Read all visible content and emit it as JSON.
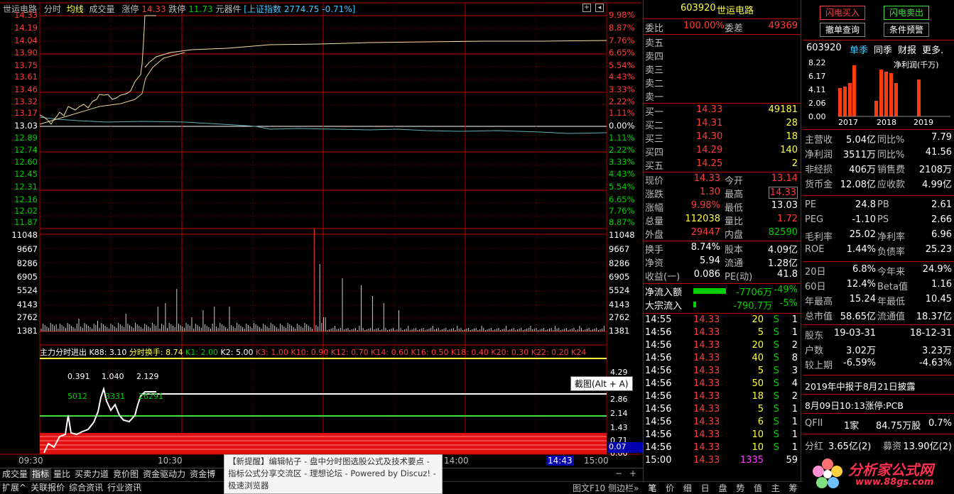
{
  "header": {
    "stock_name": "世运电路",
    "tabs": [
      "分时",
      "均线",
      "成交量"
    ],
    "limit_up_label": "涨停",
    "limit_up_value": "14.33",
    "limit_down_label": "跌停",
    "limit_down_value": "11.73",
    "sector": "元器件",
    "index_text": "[上证指数",
    "index_value": "2774.75 -0.71%]"
  },
  "price_axis": [
    "14.33",
    "14.19",
    "14.04",
    "13.90",
    "13.75",
    "13.61",
    "13.46",
    "13.32",
    "13.17",
    "13.03",
    "12.89",
    "12.74",
    "12.60",
    "12.45",
    "12.31",
    "12.16",
    "12.02",
    "11.87"
  ],
  "pct_axis": [
    "9.98%",
    "8.87%",
    "7.76%",
    "6.65%",
    "5.54%",
    "4.43%",
    "3.33%",
    "2.22%",
    "1.11%",
    "0.00%",
    "1.11%",
    "2.22%",
    "3.33%",
    "4.43%",
    "5.54%",
    "6.65%",
    "7.76%",
    "8.87%"
  ],
  "volume_axis": [
    "11048",
    "9667",
    "8286",
    "6905",
    "5524",
    "4143",
    "2762",
    "1381"
  ],
  "indicator_bar": {
    "name": "主力分时进出",
    "k88": "K88: 3.10",
    "turnover": "分时换手: 8.74",
    "k1": "K1: 2.00",
    "k2": "K2: 5.00",
    "rest": "K3: 1.00  K10: 0.90  K12: 0.70  K14: 0.60  K16: 0.50  K18: 0.40  K20: 0.30  K22: 0.20  K24"
  },
  "indicator_labels": {
    "a": "0.391",
    "b": "1.040",
    "c": "2.129",
    "d": "5012",
    "e": "3331",
    "f": "26291"
  },
  "indicator_axis": [
    "4.29",
    "2.86",
    "2.14",
    "1.43",
    "0.71",
    "0.00"
  ],
  "indicator_current": "0.07",
  "time_axis": {
    "t1": "09:30",
    "t2": "10:30",
    "t3": "14:00",
    "t4": "14:43",
    "t5": "15:00"
  },
  "tooltip": "截图(Alt + A)",
  "bottom_tabs": [
    "成交量",
    "指标",
    "量比",
    "买卖力道",
    "竞价图",
    "资金驱动力",
    "资金博"
  ],
  "bottom_tabs2": [
    "扩展^",
    "关联报价",
    "综合资讯",
    "行业资讯"
  ],
  "bottom_right": {
    "f10": "图文F10",
    "side": "侧边栏»"
  },
  "popup": "【新提醒】编辑帖子 - 盘中分时图选股公式及技术要点 - 指标公式分享交流区 - 理想论坛 - Powered by Discuz! - 极速浏览器",
  "quote": {
    "code": "603920",
    "name": "世运电路",
    "weibi_label": "委比",
    "weibi": "100.00%",
    "weicha_label": "委差",
    "weicha": "49369",
    "sells": [
      "卖五",
      "卖四",
      "卖三",
      "卖二",
      "卖一"
    ],
    "buys": [
      {
        "label": "买一",
        "price": "14.33",
        "vol": "49181"
      },
      {
        "label": "买二",
        "price": "14.31",
        "vol": "28"
      },
      {
        "label": "买三",
        "price": "14.30",
        "vol": "18"
      },
      {
        "label": "买四",
        "price": "14.29",
        "vol": "140"
      },
      {
        "label": "买五",
        "price": "14.25",
        "vol": "2"
      }
    ],
    "stats": [
      {
        "l1": "现价",
        "v1": "14.33",
        "l2": "今开",
        "v2": "13.14"
      },
      {
        "l1": "涨跌",
        "v1": "1.30",
        "l2": "最高",
        "v2": "14.33"
      },
      {
        "l1": "涨幅",
        "v1": "9.98%",
        "l2": "最低",
        "v2": "13.03"
      },
      {
        "l1": "总量",
        "v1": "112038",
        "l2": "量比",
        "v2": "1.72"
      },
      {
        "l1": "外盘",
        "v1": "29447",
        "l2": "内盘",
        "v2": "82590"
      }
    ],
    "stats2": [
      {
        "l1": "换手",
        "v1": "8.74%",
        "l2": "股本",
        "v2": "4.09亿"
      },
      {
        "l1": "净资",
        "v1": "5.94",
        "l2": "流通",
        "v2": "1.28亿"
      },
      {
        "l1": "收益(一)",
        "v1": "0.086",
        "l2": "PE(动)",
        "v2": "41.8"
      }
    ],
    "flow": [
      {
        "label": "净流入额",
        "value": "-7706万",
        "pct": "-49%"
      },
      {
        "label": "大宗流入",
        "value": "-790.7万",
        "pct": "-5%"
      }
    ],
    "ticks": [
      {
        "t": "14:55",
        "p": "14.33",
        "v": "20",
        "s": "S",
        "n": "1"
      },
      {
        "t": "14:56",
        "p": "14.33",
        "v": "5",
        "s": "S",
        "n": "1"
      },
      {
        "t": "14:56",
        "p": "14.33",
        "v": "20",
        "s": "S",
        "n": "2"
      },
      {
        "t": "14:56",
        "p": "14.33",
        "v": "40",
        "s": "S",
        "n": "8"
      },
      {
        "t": "14:56",
        "p": "14.33",
        "v": "5",
        "s": "S",
        "n": "3"
      },
      {
        "t": "14:56",
        "p": "14.33",
        "v": "50",
        "s": "S",
        "n": "4"
      },
      {
        "t": "14:56",
        "p": "14.33",
        "v": "18",
        "s": "S",
        "n": "2"
      },
      {
        "t": "14:56",
        "p": "14.33",
        "v": "5",
        "s": "S",
        "n": "1"
      },
      {
        "t": "14:56",
        "p": "14.33",
        "v": "6",
        "s": "S",
        "n": "1"
      },
      {
        "t": "14:56",
        "p": "14.33",
        "v": "10",
        "s": "S",
        "n": "1"
      },
      {
        "t": "14:56",
        "p": "14.33",
        "v": "10",
        "s": "S",
        "n": "1"
      },
      {
        "t": "15:00",
        "p": "14.33",
        "v": "1335",
        "s": "",
        "n": "59"
      }
    ],
    "bottom_tabs": [
      "笔",
      "价",
      "细",
      "日",
      "盘",
      "势",
      "值",
      "主",
      "筹"
    ]
  },
  "fin": {
    "buttons": {
      "flash_buy": "闪电买入",
      "flash_sell": "闪电卖出",
      "cancel": "撤单查询",
      "cond": "条件预警"
    },
    "code": "603920",
    "tabs": [
      "单季",
      "同季",
      "财报",
      "更多."
    ],
    "chart_title": "净利润(千万)",
    "chart_yaxis": [
      "8.22",
      "6.17",
      "4.11",
      "2.06",
      "0.00"
    ],
    "chart_xaxis": [
      "2017",
      "2018",
      "2019"
    ],
    "rows1": [
      {
        "l1": "主营收",
        "v1": "5.04亿",
        "l2": "同比%",
        "v2": "7.79"
      },
      {
        "l1": "净利润",
        "v1": "3511万",
        "l2": "同比%",
        "v2": "41.56"
      },
      {
        "l1": "非经损",
        "v1": "406万",
        "l2": "销售费",
        "v2": "2108万"
      },
      {
        "l1": "货币金",
        "v1": "12.08亿",
        "l2": "应收款",
        "v2": "4.99亿"
      }
    ],
    "rows2": [
      {
        "l1": "PE",
        "v1": "24.8",
        "l2": "PB",
        "v2": "2.61"
      },
      {
        "l1": "PEG",
        "v1": "-1.10",
        "l2": "PS",
        "v2": "2.66"
      },
      {
        "l1": "毛利率",
        "v1": "25.02",
        "l2": "净利率",
        "v2": "6.96"
      },
      {
        "l1": "ROE",
        "v1": "1.44%",
        "l2": "负债率",
        "v2": "25.23"
      }
    ],
    "rows3": [
      {
        "l1": "20日",
        "v1": "6.8%",
        "l2": "今年来",
        "v2": "24.9%"
      },
      {
        "l1": "60日",
        "v1": "12.4%",
        "l2": "Beta值",
        "v2": "1.16"
      },
      {
        "l1": "年最高",
        "v1": "15.24",
        "l2": "年最低",
        "v2": "10.45"
      },
      {
        "l1": "总市值",
        "v1": "58.65亿",
        "l2": "流通值",
        "v2": "18.37亿"
      }
    ],
    "rows4": [
      {
        "l1": "股东",
        "v1": "19-03-31",
        "v2": "18-12-31"
      },
      {
        "l1": "户数",
        "v1": "3.02万",
        "v2": "3.23万"
      },
      {
        "l1": "较上期",
        "v1": "-6.59%",
        "v2": "-4.63%"
      }
    ],
    "notice1": "2019年中报于8月21日披露",
    "notice2": "8月09日10:13涨停:PCB",
    "qfii": {
      "l": "QFII",
      "v1": "1家",
      "v2": "84.75万股",
      "v3": "0.7%"
    },
    "fenhong": {
      "l": "分红",
      "v1": "3.65亿(2)",
      "l2": "募资",
      "v2": "13.90亿(2)"
    },
    "watermark": "分析家公式网",
    "watermark_url": "www.88gs.com"
  }
}
